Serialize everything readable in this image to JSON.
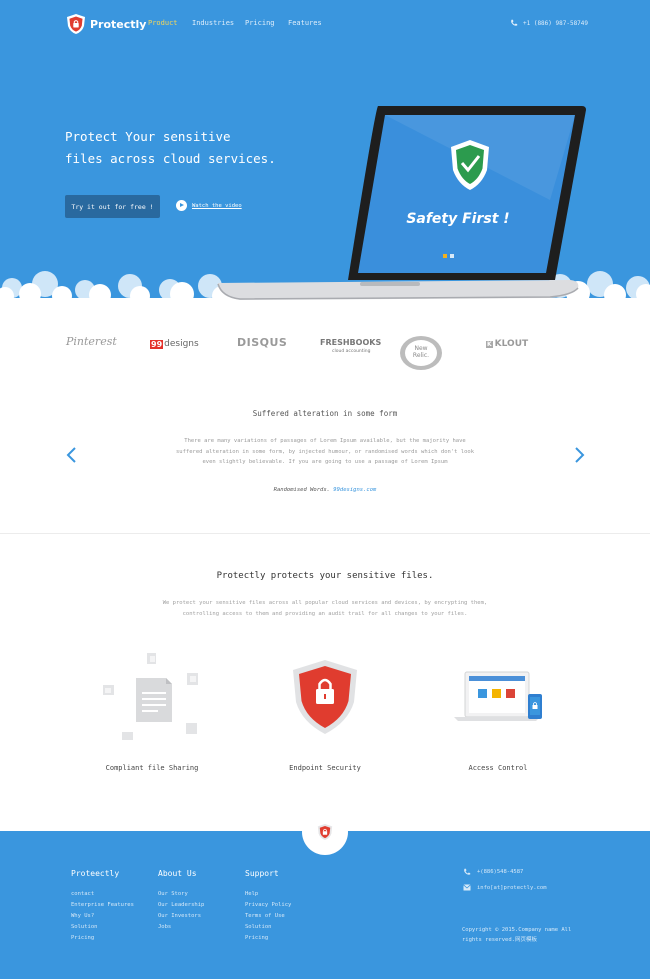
{
  "nav": {
    "logo_text": "Protectly",
    "links": [
      "Product",
      "Industries",
      "Pricing",
      "Features"
    ],
    "phone": "+1 (886) 987-58749"
  },
  "hero": {
    "title_line1": "Protect Your sensitive",
    "title_line2": "files across cloud services.",
    "cta_label": "Try it out for free !",
    "watch_label": "Watch the video",
    "screen_text": "Safety First !"
  },
  "brands": {
    "pinterest": "Pinterest",
    "ninety_nine_num": "99",
    "ninety_nine_text": "designs",
    "disqus": "DISQUS",
    "freshbooks": "FRESHBOOKS",
    "freshbooks_sub": "cloud accounting",
    "newrelic_line1": "New",
    "newrelic_line2": "Relic.",
    "klout_mark": "K",
    "klout": "KLOUT"
  },
  "testimonial": {
    "title": "Suffered alteration in some form",
    "body": "There are many variations of passages of Lorem Ipsum available, but the majority have suffered alteration in some form, by injected humour, or randomised words which don't look even slightly believable. If you are going to use a passage of Lorem Ipsum",
    "author_label": "Randomised Words.",
    "author_site": "99designs.com"
  },
  "features": {
    "title": "Protectly protects your sensitive files.",
    "body": "We protect your sensitive files across all popular cloud services and devices, by encrypting them, controlling access to them and providing an audit trail for all changes to your files.",
    "items": [
      {
        "label": "Compliant file Sharing",
        "icon": "file-sharing-icon"
      },
      {
        "label": "Endpoint Security",
        "icon": "shield-lock-icon"
      },
      {
        "label": "Access Control",
        "icon": "devices-icon"
      }
    ]
  },
  "footer": {
    "columns": [
      {
        "heading": "Proteectly",
        "items": [
          "contact",
          "Enterprise Features",
          "Why Us?",
          "Solution",
          "Pricing"
        ]
      },
      {
        "heading": "About Us",
        "items": [
          "Our Story",
          "Our Leadership",
          "Our Investors",
          "Jobs"
        ]
      },
      {
        "heading": "Support",
        "items": [
          "Help",
          "Privacy Policy",
          "Terms of Use",
          "Solution",
          "Pricing"
        ]
      }
    ],
    "phone": "+(886)548-4587",
    "email": "info[at]protectly.com",
    "copyright_line1": "Copyright © 2015.Company name All",
    "copyright_line2": "rights reserved.网页模板"
  },
  "colors": {
    "primary": "#3a96de",
    "cta": "#29699f",
    "active_nav": "#f3d75a",
    "shield_red": "#e03c2f"
  }
}
